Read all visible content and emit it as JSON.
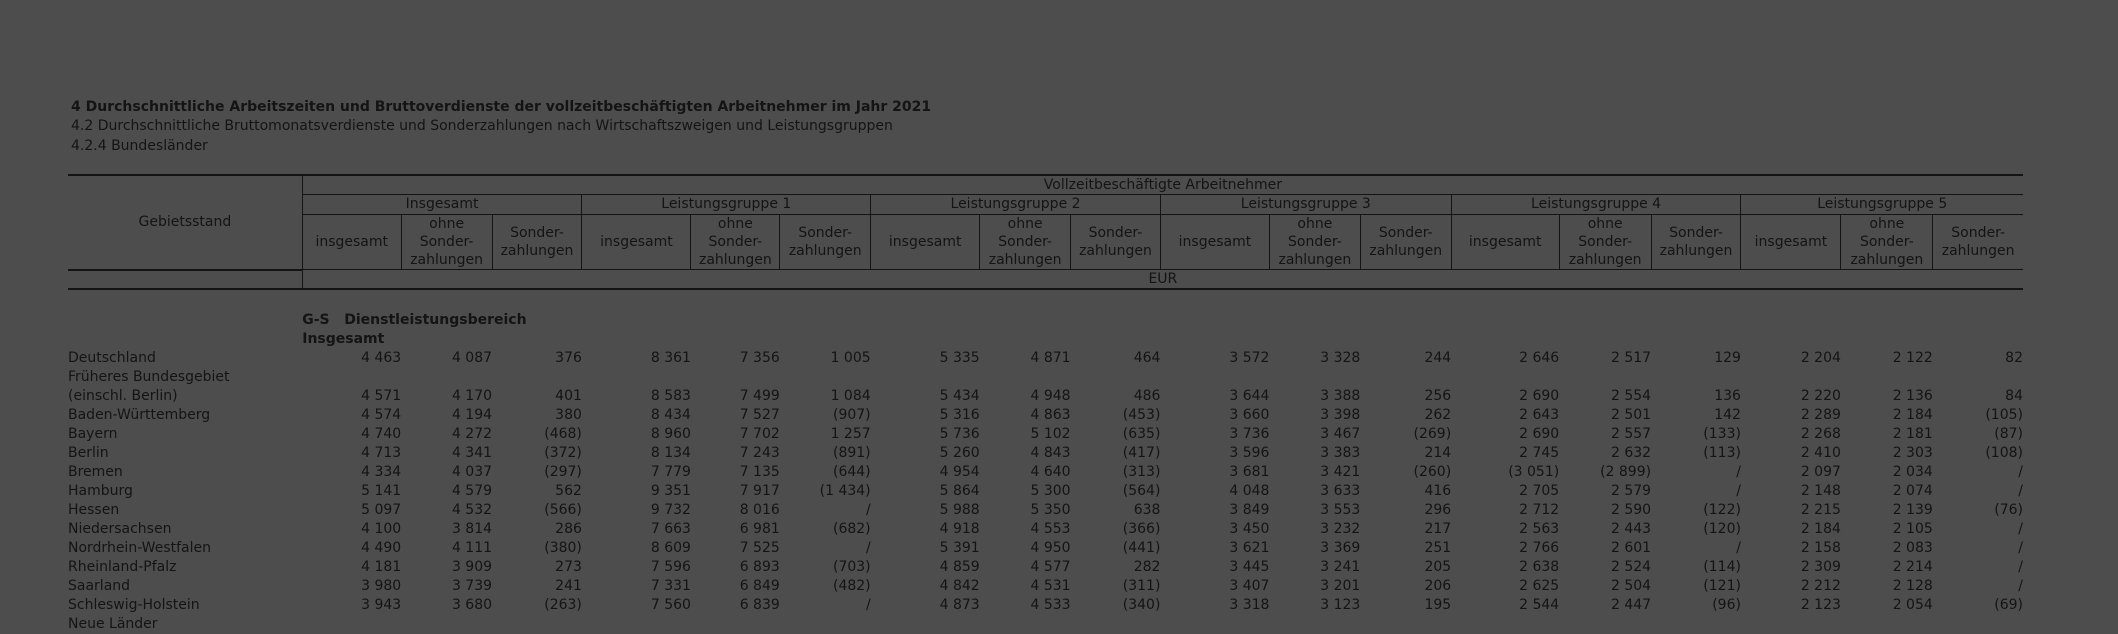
{
  "document": {
    "title": "4 Durchschnittliche Arbeitszeiten und Bruttoverdienste der vollzeitbeschäftigten Arbeitnehmer im Jahr 2021",
    "subtitle": "4.2 Durchschnittliche Bruttomonatsverdienste und Sonderzahlungen nach Wirtschaftszweigen und Leistungsgruppen",
    "subsubtitle": "4.2.4 Bundesländer"
  },
  "table": {
    "stub_header": "Gebietsstand",
    "super_header": "Vollzeitbeschäftigte Arbeitnehmer",
    "group_headers": [
      "Insgesamt",
      "Leistungsgruppe 1",
      "Leistungsgruppe 2",
      "Leistungsgruppe 3",
      "Leistungsgruppe 4",
      "Leistungsgruppe 5"
    ],
    "sub_headers": [
      "insgesamt",
      "ohne\nSonder-\nzahlungen",
      "Sonder-\nzahlungen"
    ],
    "unit": "EUR",
    "section_code": "G-S",
    "section_label": "Dienstleistungsbereich",
    "subsection": "Insgesamt",
    "rows": [
      {
        "label": "Deutschland",
        "level": 0,
        "values": [
          "4 463",
          "4 087",
          "376",
          "8 361",
          "7 356",
          "1 005",
          "5 335",
          "4 871",
          "464",
          "3 572",
          "3 328",
          "244",
          "2 646",
          "2 517",
          "129",
          "2 204",
          "2 122",
          "82"
        ]
      },
      {
        "label": "Früheres Bundesgebiet",
        "level": 1,
        "values": []
      },
      {
        "label": "(einschl. Berlin)",
        "level": 2,
        "values": [
          "4 571",
          "4 170",
          "401",
          "8 583",
          "7 499",
          "1 084",
          "5 434",
          "4 948",
          "486",
          "3 644",
          "3 388",
          "256",
          "2 690",
          "2 554",
          "136",
          "2 220",
          "2 136",
          "84"
        ]
      },
      {
        "label": "Baden-Württemberg",
        "level": 2,
        "values": [
          "4 574",
          "4 194",
          "380",
          "8 434",
          "7 527",
          "(907)",
          "5 316",
          "4 863",
          "(453)",
          "3 660",
          "3 398",
          "262",
          "2 643",
          "2 501",
          "142",
          "2 289",
          "2 184",
          "(105)"
        ]
      },
      {
        "label": "Bayern",
        "level": 2,
        "values": [
          "4 740",
          "4 272",
          "(468)",
          "8 960",
          "7 702",
          "1 257",
          "5 736",
          "5 102",
          "(635)",
          "3 736",
          "3 467",
          "(269)",
          "2 690",
          "2 557",
          "(133)",
          "2 268",
          "2 181",
          "(87)"
        ]
      },
      {
        "label": "Berlin",
        "level": 2,
        "values": [
          "4 713",
          "4 341",
          "(372)",
          "8 134",
          "7 243",
          "(891)",
          "5 260",
          "4 843",
          "(417)",
          "3 596",
          "3 383",
          "214",
          "2 745",
          "2 632",
          "(113)",
          "2 410",
          "2 303",
          "(108)"
        ]
      },
      {
        "label": "Bremen",
        "level": 2,
        "values": [
          "4 334",
          "4 037",
          "(297)",
          "7 779",
          "7 135",
          "(644)",
          "4 954",
          "4 640",
          "(313)",
          "3 681",
          "3 421",
          "(260)",
          "(3 051)",
          "(2 899)",
          "/",
          "2 097",
          "2 034",
          "/"
        ]
      },
      {
        "label": "Hamburg",
        "level": 2,
        "values": [
          "5 141",
          "4 579",
          "562",
          "9 351",
          "7 917",
          "(1 434)",
          "5 864",
          "5 300",
          "(564)",
          "4 048",
          "3 633",
          "416",
          "2 705",
          "2 579",
          "/",
          "2 148",
          "2 074",
          "/"
        ]
      },
      {
        "label": "Hessen",
        "level": 2,
        "values": [
          "5 097",
          "4 532",
          "(566)",
          "9 732",
          "8 016",
          "/",
          "5 988",
          "5 350",
          "638",
          "3 849",
          "3 553",
          "296",
          "2 712",
          "2 590",
          "(122)",
          "2 215",
          "2 139",
          "(76)"
        ]
      },
      {
        "label": "Niedersachsen",
        "level": 2,
        "values": [
          "4 100",
          "3 814",
          "286",
          "7 663",
          "6 981",
          "(682)",
          "4 918",
          "4 553",
          "(366)",
          "3 450",
          "3 232",
          "217",
          "2 563",
          "2 443",
          "(120)",
          "2 184",
          "2 105",
          "/"
        ]
      },
      {
        "label": "Nordrhein-Westfalen",
        "level": 2,
        "values": [
          "4 490",
          "4 111",
          "(380)",
          "8 609",
          "7 525",
          "/",
          "5 391",
          "4 950",
          "(441)",
          "3 621",
          "3 369",
          "251",
          "2 766",
          "2 601",
          "/",
          "2 158",
          "2 083",
          "/"
        ]
      },
      {
        "label": "Rheinland-Pfalz",
        "level": 2,
        "values": [
          "4 181",
          "3 909",
          "273",
          "7 596",
          "6 893",
          "(703)",
          "4 859",
          "4 577",
          "282",
          "3 445",
          "3 241",
          "205",
          "2 638",
          "2 524",
          "(114)",
          "2 309",
          "2 214",
          "/"
        ]
      },
      {
        "label": "Saarland",
        "level": 2,
        "values": [
          "3 980",
          "3 739",
          "241",
          "7 331",
          "6 849",
          "(482)",
          "4 842",
          "4 531",
          "(311)",
          "3 407",
          "3 201",
          "206",
          "2 625",
          "2 504",
          "(121)",
          "2 212",
          "2 128",
          "/"
        ]
      },
      {
        "label": "Schleswig-Holstein",
        "level": 2,
        "values": [
          "3 943",
          "3 680",
          "(263)",
          "7 560",
          "6 839",
          "/",
          "4 873",
          "4 533",
          "(340)",
          "3 318",
          "3 123",
          "195",
          "2 544",
          "2 447",
          "(96)",
          "2 123",
          "2 054",
          "(69)"
        ]
      },
      {
        "label": "Neue Länder",
        "level": 1,
        "values": []
      }
    ]
  }
}
